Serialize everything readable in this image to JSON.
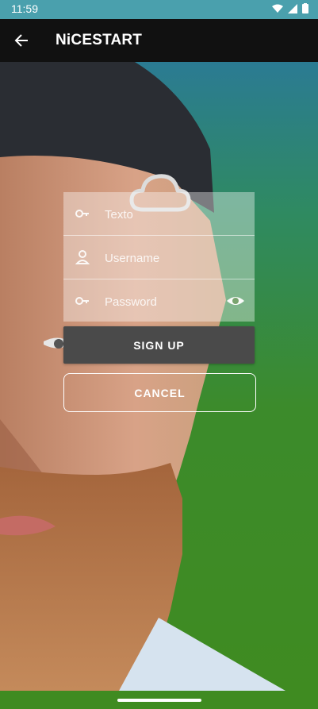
{
  "status": {
    "time": "11:59",
    "icons": [
      "wifi-icon",
      "signal-icon",
      "battery-icon"
    ]
  },
  "appbar": {
    "title": "NiCESTART",
    "back_icon": "back-arrow-icon"
  },
  "logo": {
    "icon": "cloud-icon"
  },
  "form": {
    "texto_placeholder": "Texto",
    "username_placeholder": "Username",
    "password_placeholder": "Password"
  },
  "buttons": {
    "signup": "SIGN UP",
    "cancel": "CANCEL"
  },
  "colors": {
    "gradient_top": "#2b7b93",
    "gradient_bottom": "#3f8b21",
    "button_dark": "#4a4a4a"
  }
}
